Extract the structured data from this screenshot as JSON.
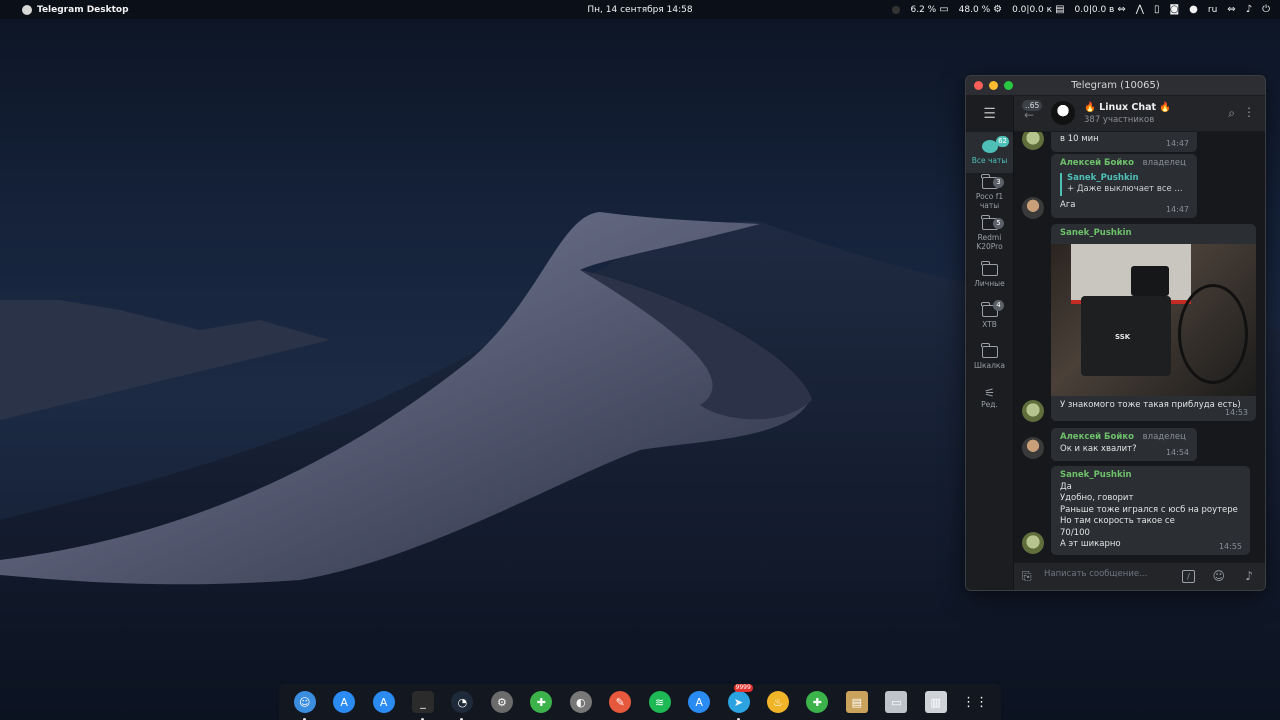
{
  "menubar": {
    "app_name": "Telegram Desktop",
    "datetime": "Пн, 14 сентября  14:58",
    "cpu": "6.2 %",
    "mem": "48.0 %",
    "net1": "0.0|0.0 к",
    "net2": "0.0|0.0 в",
    "lang": "ru"
  },
  "window": {
    "title": "Telegram (10065)"
  },
  "sidebar": {
    "folders": [
      {
        "label": "Все чаты",
        "badge": "62"
      },
      {
        "label": "Poco f1 чаты",
        "badge": "3"
      },
      {
        "label": "Redmi K20Pro",
        "badge": "5"
      },
      {
        "label": "Личные",
        "badge": ""
      },
      {
        "label": "XTB",
        "badge": "4"
      },
      {
        "label": "Шкалка",
        "badge": ""
      },
      {
        "label": "Ред.",
        "badge": ""
      }
    ]
  },
  "header": {
    "back_count": "..65",
    "chat_name": "🔥 Linux Chat 🔥",
    "members": "387 участников"
  },
  "messages": [
    {
      "text": "в 10 мин",
      "time": "14:47"
    },
    {
      "author": "Алексей Бойко",
      "role": "владелец",
      "reply_author": "Sanek_Pushkin",
      "reply_text": "+ Даже выключает все ...",
      "text": "Ага",
      "time": "14:47"
    },
    {
      "author": "Sanek_Pushkin",
      "caption": "У знакомого тоже такая приблуда есть)",
      "time": "14:53"
    },
    {
      "author": "Алексей Бойко",
      "role": "владелец",
      "text": "Ок и как хвалит?",
      "time": "14:54"
    },
    {
      "author": "Sanek_Pushkin",
      "lines": [
        "Да",
        "Удобно, говорит",
        "Раньше тоже игрался с юсб на роутере",
        "Но там скорость такое се",
        "70/100",
        "А эт шикарно"
      ],
      "time": "14:55"
    }
  ],
  "photo": {
    "brand": "SSK"
  },
  "input": {
    "placeholder": "Написать сообщение..."
  },
  "dock": {
    "telegram_badge": "9999"
  },
  "colors": {
    "accent": "#4ec0b8",
    "author_green": "#6ec06b"
  }
}
